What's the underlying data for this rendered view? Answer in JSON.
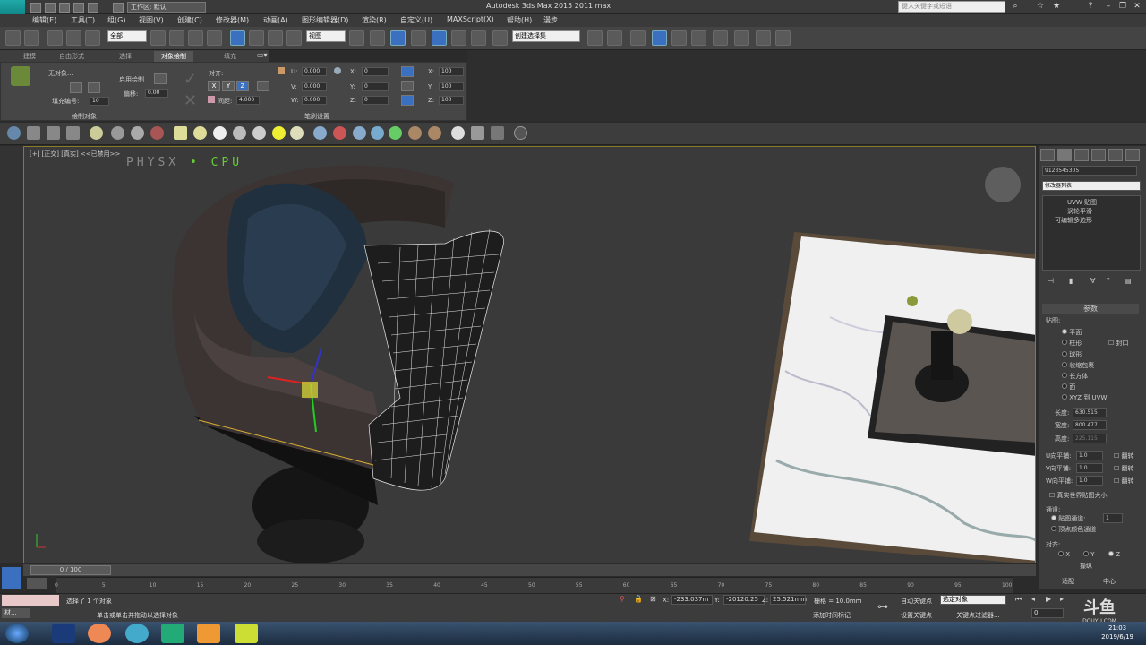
{
  "window": {
    "title": "Autodesk 3ds Max  2015      2011.max",
    "workspace": "工作区: 默认",
    "search_placeholder": "键入关键字或短语",
    "app_logo": "MAX"
  },
  "menu": [
    "编辑(E)",
    "工具(T)",
    "组(G)",
    "视图(V)",
    "创建(C)",
    "修改器(M)",
    "动画(A)",
    "图形编辑器(D)",
    "渲染(R)",
    "自定义(U)",
    "MAXScript(X)",
    "帮助(H)",
    "漫步"
  ],
  "toolbar": {
    "selection_filter": "全部",
    "ref_coord": "视图",
    "named_selection": "创建选择集"
  },
  "ribbon": {
    "tabs": [
      "建模",
      "自由形式",
      "选择",
      "对象绘制",
      "填充"
    ],
    "active_tab": "对象绘制",
    "no_object": "无对象...",
    "fill_number_label": "填充编号:",
    "fill_number_value": "10",
    "enable_paint": "启用绘制",
    "offset_label": "偏移:",
    "offset_value": "0.00",
    "align_label": "对齐:",
    "axes": [
      "X",
      "Y",
      "Z"
    ],
    "spacing_label": "间距:",
    "spacing_value": "4.000",
    "u_label": "U:",
    "u_value": "0.000",
    "v_label": "V:",
    "v_value": "0.000",
    "w_label": "W:",
    "w_value": "0.000",
    "rx_label": "X:",
    "rx_value": "0",
    "ry_label": "Y:",
    "ry_value": "0",
    "rz_label": "Z:",
    "rz_value": "0",
    "sx_label": "X:",
    "sx_value": "100",
    "sy_label": "Y:",
    "sy_value": "100",
    "sz_label": "Z:",
    "sz_value": "100",
    "group_paint_objects": "绘制对象",
    "group_brush_settings": "笔刷设置"
  },
  "viewport": {
    "label": "[+] [正交] [真实] <<已禁用>>",
    "physx_a": "PHYSX",
    "physx_sep": "•",
    "physx_b": "CPU"
  },
  "command_panel": {
    "object_name": "9123545305",
    "modifier_list": "修改器列表",
    "stack": [
      "UVW 贴图",
      "涡轮平滑",
      "可编辑多边形"
    ],
    "rollout_title": "参数",
    "mapping_label": "贴图:",
    "mapping_options": [
      "平面",
      "柱形",
      "球形",
      "收缩包裹",
      "长方体",
      "面",
      "XYZ 到 UVW"
    ],
    "cap_label": "封口",
    "length_label": "长度:",
    "length_value": "630.515",
    "width_label": "宽度:",
    "width_value": "800.477",
    "height_label": "高度:",
    "height_value": "225.115",
    "utile_label": "U向平铺:",
    "utile_value": "1.0",
    "vtile_label": "V向平铺:",
    "vtile_value": "1.0",
    "wtile_label": "W向平铺:",
    "wtile_value": "1.0",
    "flip_label": "翻转",
    "real_world": "真实世界贴图大小",
    "channel_label": "通道:",
    "map_channel": "贴图通道:",
    "map_channel_value": "1",
    "vertex_color": "顶点颜色通道",
    "alignment_label": "对齐:",
    "align_axes": [
      "X",
      "Y",
      "Z"
    ],
    "manipulate": "操纵",
    "fit": "适配",
    "center": "中心"
  },
  "timeline": {
    "frame": "0 / 100",
    "ticks": [
      "0",
      "5",
      "10",
      "15",
      "20",
      "25",
      "30",
      "35",
      "40",
      "45",
      "50",
      "55",
      "60",
      "65",
      "70",
      "75",
      "80",
      "85",
      "90",
      "95",
      "100"
    ]
  },
  "status": {
    "selected": "选择了 1 个对象",
    "prompt": "单击或单击并拖动以选择对象",
    "maxscript": "材...",
    "x_label": "X:",
    "x_value": "-233.037m",
    "y_label": "Y:",
    "y_value": "-20120.25",
    "z_label": "Z:",
    "z_value": "25.521mm",
    "grid": "栅格 = 10.0mm",
    "add_time_tag": "添加时间标记",
    "auto_key": "自动关键点",
    "set_key": "设置关键点",
    "selected_objects": "选定对象",
    "key_filters": "关键点过滤器...",
    "frame_field": "0"
  },
  "taskbar": {
    "time": "21:03",
    "date": "2019/6/19",
    "watermark": "斗鱼",
    "watermark_sub": "DOUYU.COM"
  },
  "colors": {
    "accent_blue": "#3b6fbf",
    "viewport_border": "#8a7a2a",
    "physx_green": "#66cc33"
  }
}
